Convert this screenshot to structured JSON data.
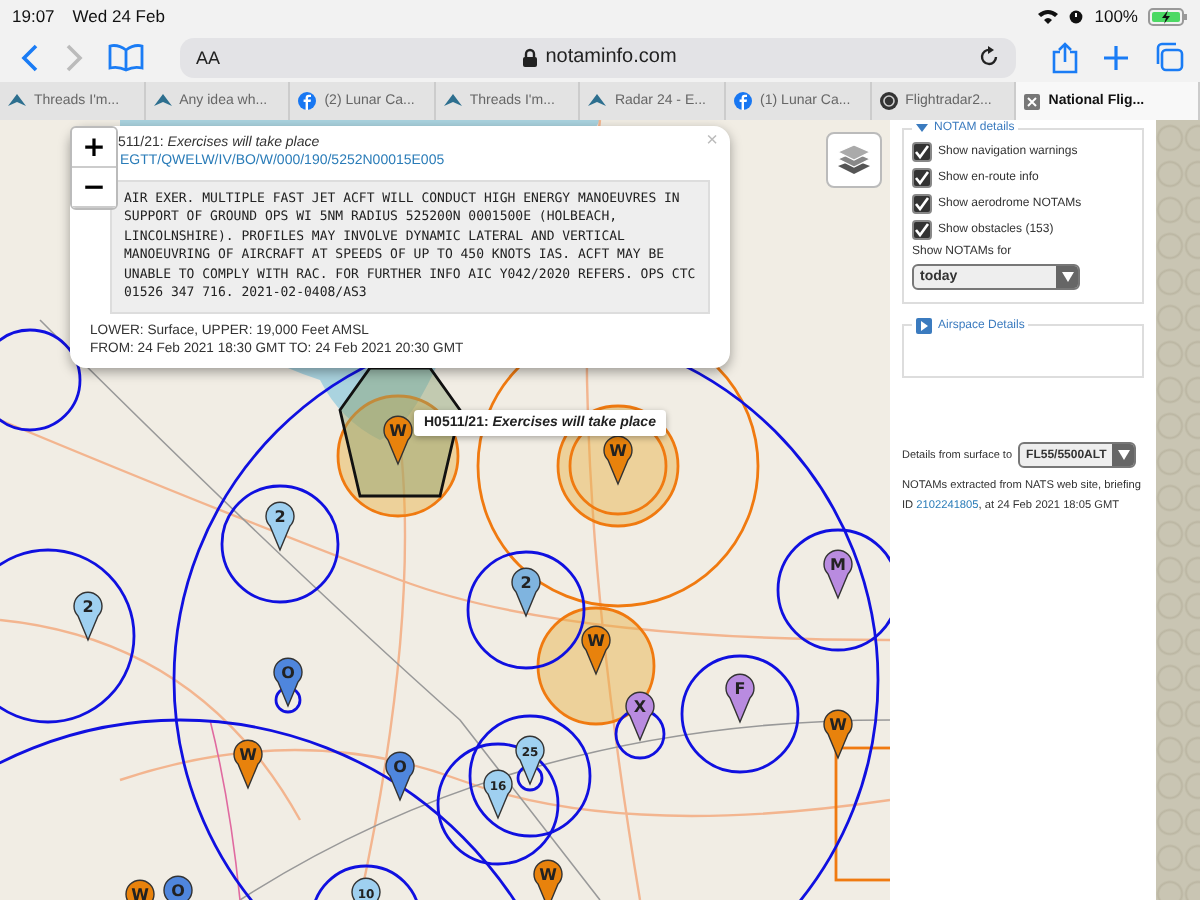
{
  "status_bar": {
    "time": "19:07",
    "date": "Wed 24 Feb",
    "battery": "100%"
  },
  "toolbar": {
    "forward_disabled": true,
    "reader": "AA",
    "url": "notaminfo.com"
  },
  "tabs": [
    {
      "label": "Threads I'm...",
      "selected": false,
      "kind": "plane"
    },
    {
      "label": "Any idea wh...",
      "selected": false,
      "kind": "plane"
    },
    {
      "label": "(2) Lunar Ca...",
      "selected": false,
      "kind": "fb"
    },
    {
      "label": "Threads I'm...",
      "selected": false,
      "kind": "plane"
    },
    {
      "label": "Radar 24 - E...",
      "selected": false,
      "kind": "plane"
    },
    {
      "label": "(1) Lunar Ca...",
      "selected": false,
      "kind": "fb"
    },
    {
      "label": "Flightradar2...",
      "selected": false,
      "kind": "radar"
    },
    {
      "label": "National Flig...",
      "selected": true,
      "kind": "close"
    }
  ],
  "map": {
    "zoom_in": "+",
    "zoom_out": "−",
    "popup": {
      "title_id": "511/21: ",
      "title_text": "Exercises will take place",
      "link": "EGTT/QWELW/IV/BO/W/000/190/5252N00015E005",
      "body": "AIR EXER. MULTIPLE FAST JET ACFT WILL CONDUCT HIGH ENERGY MANOEUVRES IN SUPPORT OF GROUND OPS WI 5NM RADIUS 525200N 0001500E (HOLBEACH, LINCOLNSHIRE). PROFILES MAY INVOLVE DYNAMIC LATERAL AND VERTICAL MANOEUVRING OF AIRCRAFT AT SPEEDS OF UP TO 450 KNOTS IAS. ACFT MAY BE UNABLE TO COMPLY WITH RAC. FOR FURTHER INFO AIC Y042/2020 REFERS. OPS CTC 01526 347 716. 2021-02-0408/AS3",
      "limits": "LOWER: Surface, UPPER: 19,000 Feet AMSL",
      "times": "FROM: 24 Feb 2021 18:30 GMT TO: 24 Feb 2021 20:30 GMT",
      "close": "×"
    },
    "tooltip": {
      "id": "H0511/21: ",
      "text": "Exercises will take place"
    },
    "markers": [
      {
        "label": "W",
        "color": "#e8820c"
      },
      {
        "label": "W",
        "color": "#e8820c"
      },
      {
        "label": "2",
        "color": "#9fd0f0"
      },
      {
        "label": "2",
        "color": "#9fd0f0"
      },
      {
        "label": "2",
        "color": "#7fb4df"
      },
      {
        "label": "M",
        "color": "#b98be0"
      },
      {
        "label": "W",
        "color": "#e8820c"
      },
      {
        "label": "O",
        "color": "#4f86dd"
      },
      {
        "label": "F",
        "color": "#b98be0"
      },
      {
        "label": "X",
        "color": "#b98be0"
      },
      {
        "label": "W",
        "color": "#e8820c"
      },
      {
        "label": "O",
        "color": "#4f86dd"
      },
      {
        "label": "25",
        "color": "#9fd0f0"
      },
      {
        "label": "16",
        "color": "#9fd0f0"
      },
      {
        "label": "W",
        "color": "#e8820c"
      },
      {
        "label": "W",
        "color": "#e8820c"
      },
      {
        "label": "W",
        "color": "#e8820c"
      },
      {
        "label": "O",
        "color": "#4f86dd"
      },
      {
        "label": "10",
        "color": "#9fd0f0"
      }
    ]
  },
  "sidebar": {
    "notam_legend": "NOTAM details",
    "expanded": true,
    "options": [
      {
        "label": "Show navigation warnings",
        "checked": true
      },
      {
        "label": "Show en-route info",
        "checked": true
      },
      {
        "label": "Show aerodrome NOTAMs",
        "checked": true
      },
      {
        "label": "Show obstacles (153)",
        "checked": true
      }
    ],
    "period_label": "Show NOTAMs for",
    "period_value": "today",
    "airspace_legend": "Airspace Details",
    "airspace_expanded": false,
    "surface_label": "Details from surface to",
    "surface_value": "FL55/5500ALT",
    "info_before": "NOTAMs extracted from NATS web site, briefing ID ",
    "info_link": "2102241805",
    "info_after": ", at 24 Feb 2021 18:05 GMT"
  }
}
